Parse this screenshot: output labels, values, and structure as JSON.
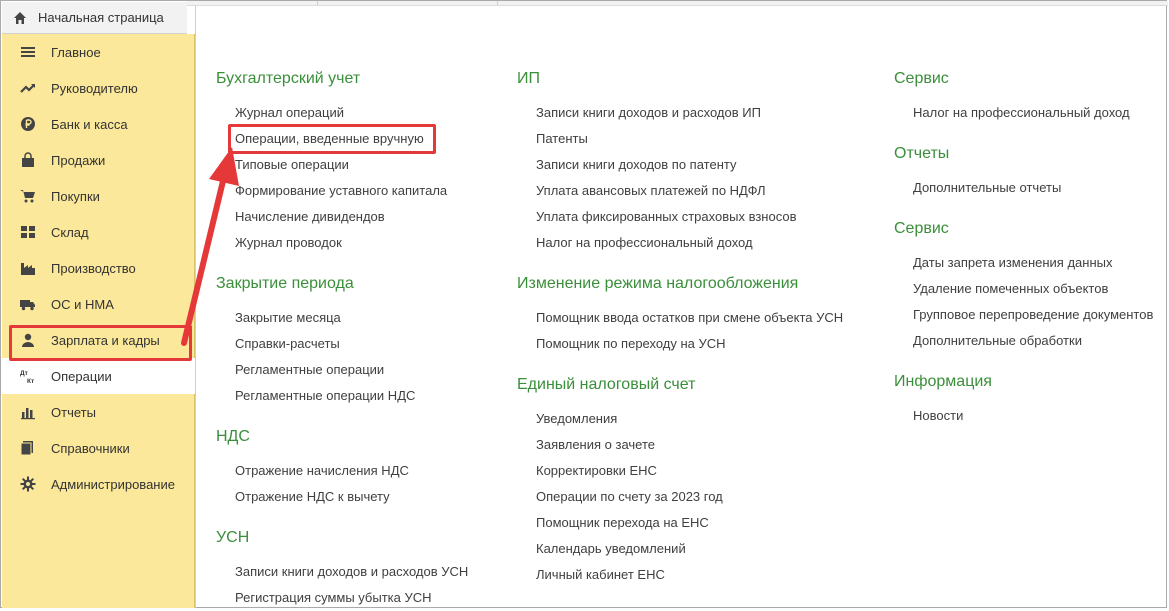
{
  "home": {
    "label": "Начальная страница",
    "icon": "home-icon"
  },
  "sidebar": {
    "items": [
      {
        "label": "Главное",
        "icon": "menu-lines-icon"
      },
      {
        "label": "Руководителю",
        "icon": "trend-up-icon"
      },
      {
        "label": "Банк и касса",
        "icon": "ruble-coin-icon"
      },
      {
        "label": "Продажи",
        "icon": "shopping-bag-icon"
      },
      {
        "label": "Покупки",
        "icon": "shopping-cart-icon"
      },
      {
        "label": "Склад",
        "icon": "warehouse-grid-icon"
      },
      {
        "label": "Производство",
        "icon": "factory-icon"
      },
      {
        "label": "ОС и НМА",
        "icon": "truck-icon"
      },
      {
        "label": "Зарплата и кадры",
        "icon": "person-icon"
      },
      {
        "label": "Операции",
        "icon": "dt-kt-icon",
        "icon_text_top": "Дт",
        "icon_text_bottom": "Кт"
      },
      {
        "label": "Отчеты",
        "icon": "bar-chart-icon"
      },
      {
        "label": "Справочники",
        "icon": "books-icon"
      },
      {
        "label": "Администрирование",
        "icon": "gear-icon"
      }
    ]
  },
  "col1": {
    "s1": {
      "title": "Бухгалтерский учет",
      "links": [
        "Журнал операций",
        "Операции, введенные вручную",
        "Типовые операции",
        "Формирование уставного капитала",
        "Начисление дивидендов",
        "Журнал проводок"
      ]
    },
    "s2": {
      "title": "Закрытие периода",
      "links": [
        "Закрытие месяца",
        "Справки-расчеты",
        "Регламентные операции",
        "Регламентные операции НДС"
      ]
    },
    "s3": {
      "title": "НДС",
      "links": [
        "Отражение начисления НДС",
        "Отражение НДС к вычету"
      ]
    },
    "s4": {
      "title": "УСН",
      "links": [
        "Записи книги доходов и расходов УСН",
        "Регистрация суммы убытка УСН"
      ]
    }
  },
  "col2": {
    "s1": {
      "title": "ИП",
      "links": [
        "Записи книги доходов и расходов ИП",
        "Патенты",
        "Записи книги доходов по патенту",
        "Уплата авансовых платежей по НДФЛ",
        "Уплата фиксированных страховых взносов",
        "Налог на профессиональный доход"
      ]
    },
    "s2": {
      "title": "Изменение режима налогообложения",
      "links": [
        "Помощник ввода остатков при смене объекта УСН",
        "Помощник по переходу на УСН"
      ]
    },
    "s3": {
      "title": "Единый налоговый счет",
      "links": [
        "Уведомления",
        "Заявления о зачете",
        "Корректировки ЕНС",
        "Операции по счету за 2023 год",
        "Помощник перехода на ЕНС",
        "Календарь уведомлений",
        "Личный кабинет ЕНС"
      ]
    }
  },
  "col3": {
    "s1": {
      "title": "Сервис",
      "links": [
        "Налог на профессиональный доход"
      ]
    },
    "s2": {
      "title": "Отчеты",
      "links": [
        "Дополнительные отчеты"
      ]
    },
    "s3": {
      "title": "Сервис",
      "links": [
        "Даты запрета изменения данных",
        "Удаление помеченных объектов",
        "Групповое перепроведение документов",
        "Дополнительные обработки"
      ]
    },
    "s4": {
      "title": "Информация",
      "links": [
        "Новости"
      ]
    }
  },
  "colors": {
    "accent_green": "#3a8f3a",
    "sidebar_yellow": "#fbe89a",
    "highlight_red": "#e53939"
  }
}
